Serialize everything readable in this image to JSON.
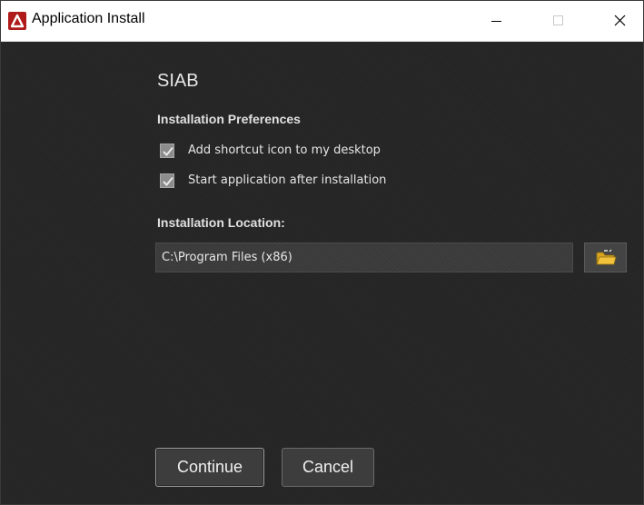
{
  "window": {
    "title": "Application Install",
    "icon": "adobe-air-icon",
    "controls": [
      "minimize-icon",
      "maximize-icon",
      "close-icon"
    ]
  },
  "app": {
    "name": "SIAB"
  },
  "preferences": {
    "heading": "Installation Preferences",
    "options": [
      {
        "label": "Add shortcut icon to my desktop",
        "checked": true
      },
      {
        "label": "Start application after installation",
        "checked": true
      }
    ]
  },
  "location": {
    "heading": "Installation Location:",
    "value": "C:\\Program Files (x86)",
    "browse_icon": "folder-icon"
  },
  "buttons": {
    "continue": "Continue",
    "cancel": "Cancel"
  },
  "colors": {
    "background": "#252525",
    "titlebar": "#ffffff",
    "icon_red": "#b01a1a",
    "folder_yellow": "#f2c23c",
    "text": "#e6e6e6"
  }
}
